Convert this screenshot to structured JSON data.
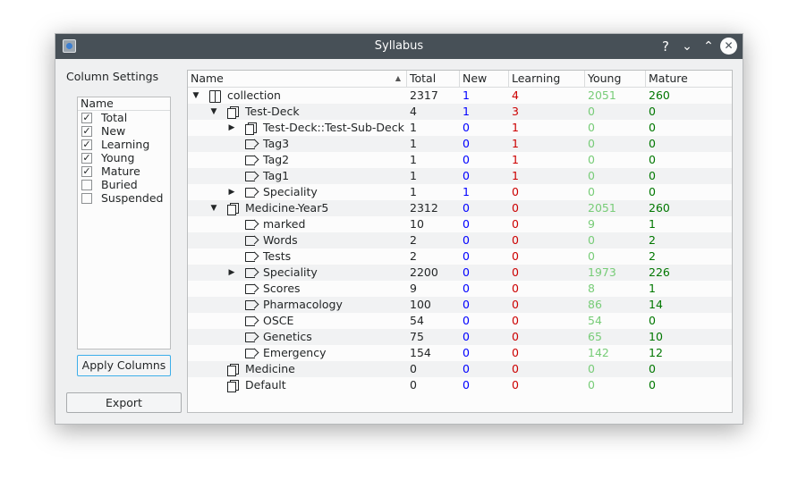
{
  "window": {
    "title": "Syllabus"
  },
  "titlebar_buttons": {
    "help": "?",
    "minimize": "⌄",
    "maximize": "⌃",
    "close": "✕"
  },
  "sidebar": {
    "label": "Column Settings",
    "list_header": "Name",
    "columns": [
      {
        "label": "Total",
        "checked": true
      },
      {
        "label": "New",
        "checked": true
      },
      {
        "label": "Learning",
        "checked": true
      },
      {
        "label": "Young",
        "checked": true
      },
      {
        "label": "Mature",
        "checked": true
      },
      {
        "label": "Buried",
        "checked": false
      },
      {
        "label": "Suspended",
        "checked": false
      }
    ],
    "apply_label": "Apply Columns",
    "export_label": "Export"
  },
  "tree": {
    "headers": [
      "Name",
      "Total",
      "New",
      "Learning",
      "Young",
      "Mature"
    ],
    "sort_column": "Name",
    "colors": {
      "new": "#0000ff",
      "learning": "#cc0000",
      "young": "#77cc77",
      "mature": "#007700"
    },
    "rows": [
      {
        "name": "collection",
        "level": 0,
        "icon": "collection-icon",
        "expand": "expanded",
        "total": "2317",
        "new": "1",
        "learning": "4",
        "young": "2051",
        "mature": "260"
      },
      {
        "name": "Test-Deck",
        "level": 1,
        "icon": "deck-icon",
        "expand": "expanded",
        "total": "4",
        "new": "1",
        "learning": "3",
        "young": "0",
        "mature": "0"
      },
      {
        "name": "Test-Deck::Test-Sub-Deck",
        "level": 2,
        "icon": "deck-icon",
        "expand": "collapsed",
        "total": "1",
        "new": "0",
        "learning": "1",
        "young": "0",
        "mature": "0"
      },
      {
        "name": "Tag3",
        "level": 2,
        "icon": "tag-icon",
        "expand": "none",
        "total": "1",
        "new": "0",
        "learning": "1",
        "young": "0",
        "mature": "0"
      },
      {
        "name": "Tag2",
        "level": 2,
        "icon": "tag-icon",
        "expand": "none",
        "total": "1",
        "new": "0",
        "learning": "1",
        "young": "0",
        "mature": "0"
      },
      {
        "name": "Tag1",
        "level": 2,
        "icon": "tag-icon",
        "expand": "none",
        "total": "1",
        "new": "0",
        "learning": "1",
        "young": "0",
        "mature": "0"
      },
      {
        "name": "Speciality",
        "level": 2,
        "icon": "tag-icon",
        "expand": "collapsed",
        "total": "1",
        "new": "1",
        "learning": "0",
        "young": "0",
        "mature": "0"
      },
      {
        "name": "Medicine-Year5",
        "level": 1,
        "icon": "deck-icon",
        "expand": "expanded",
        "total": "2312",
        "new": "0",
        "learning": "0",
        "young": "2051",
        "mature": "260"
      },
      {
        "name": "marked",
        "level": 2,
        "icon": "tag-icon",
        "expand": "none",
        "total": "10",
        "new": "0",
        "learning": "0",
        "young": "9",
        "mature": "1"
      },
      {
        "name": "Words",
        "level": 2,
        "icon": "tag-icon",
        "expand": "none",
        "total": "2",
        "new": "0",
        "learning": "0",
        "young": "0",
        "mature": "2"
      },
      {
        "name": "Tests",
        "level": 2,
        "icon": "tag-icon",
        "expand": "none",
        "total": "2",
        "new": "0",
        "learning": "0",
        "young": "0",
        "mature": "2"
      },
      {
        "name": "Speciality",
        "level": 2,
        "icon": "tag-icon",
        "expand": "collapsed",
        "total": "2200",
        "new": "0",
        "learning": "0",
        "young": "1973",
        "mature": "226"
      },
      {
        "name": "Scores",
        "level": 2,
        "icon": "tag-icon",
        "expand": "none",
        "total": "9",
        "new": "0",
        "learning": "0",
        "young": "8",
        "mature": "1"
      },
      {
        "name": "Pharmacology",
        "level": 2,
        "icon": "tag-icon",
        "expand": "none",
        "total": "100",
        "new": "0",
        "learning": "0",
        "young": "86",
        "mature": "14"
      },
      {
        "name": "OSCE",
        "level": 2,
        "icon": "tag-icon",
        "expand": "none",
        "total": "54",
        "new": "0",
        "learning": "0",
        "young": "54",
        "mature": "0"
      },
      {
        "name": "Genetics",
        "level": 2,
        "icon": "tag-icon",
        "expand": "none",
        "total": "75",
        "new": "0",
        "learning": "0",
        "young": "65",
        "mature": "10"
      },
      {
        "name": "Emergency",
        "level": 2,
        "icon": "tag-icon",
        "expand": "none",
        "total": "154",
        "new": "0",
        "learning": "0",
        "young": "142",
        "mature": "12"
      },
      {
        "name": "Medicine",
        "level": 1,
        "icon": "deck-icon",
        "expand": "none",
        "total": "0",
        "new": "0",
        "learning": "0",
        "young": "0",
        "mature": "0"
      },
      {
        "name": "Default",
        "level": 1,
        "icon": "deck-icon",
        "expand": "none",
        "total": "0",
        "new": "0",
        "learning": "0",
        "young": "0",
        "mature": "0"
      }
    ]
  }
}
